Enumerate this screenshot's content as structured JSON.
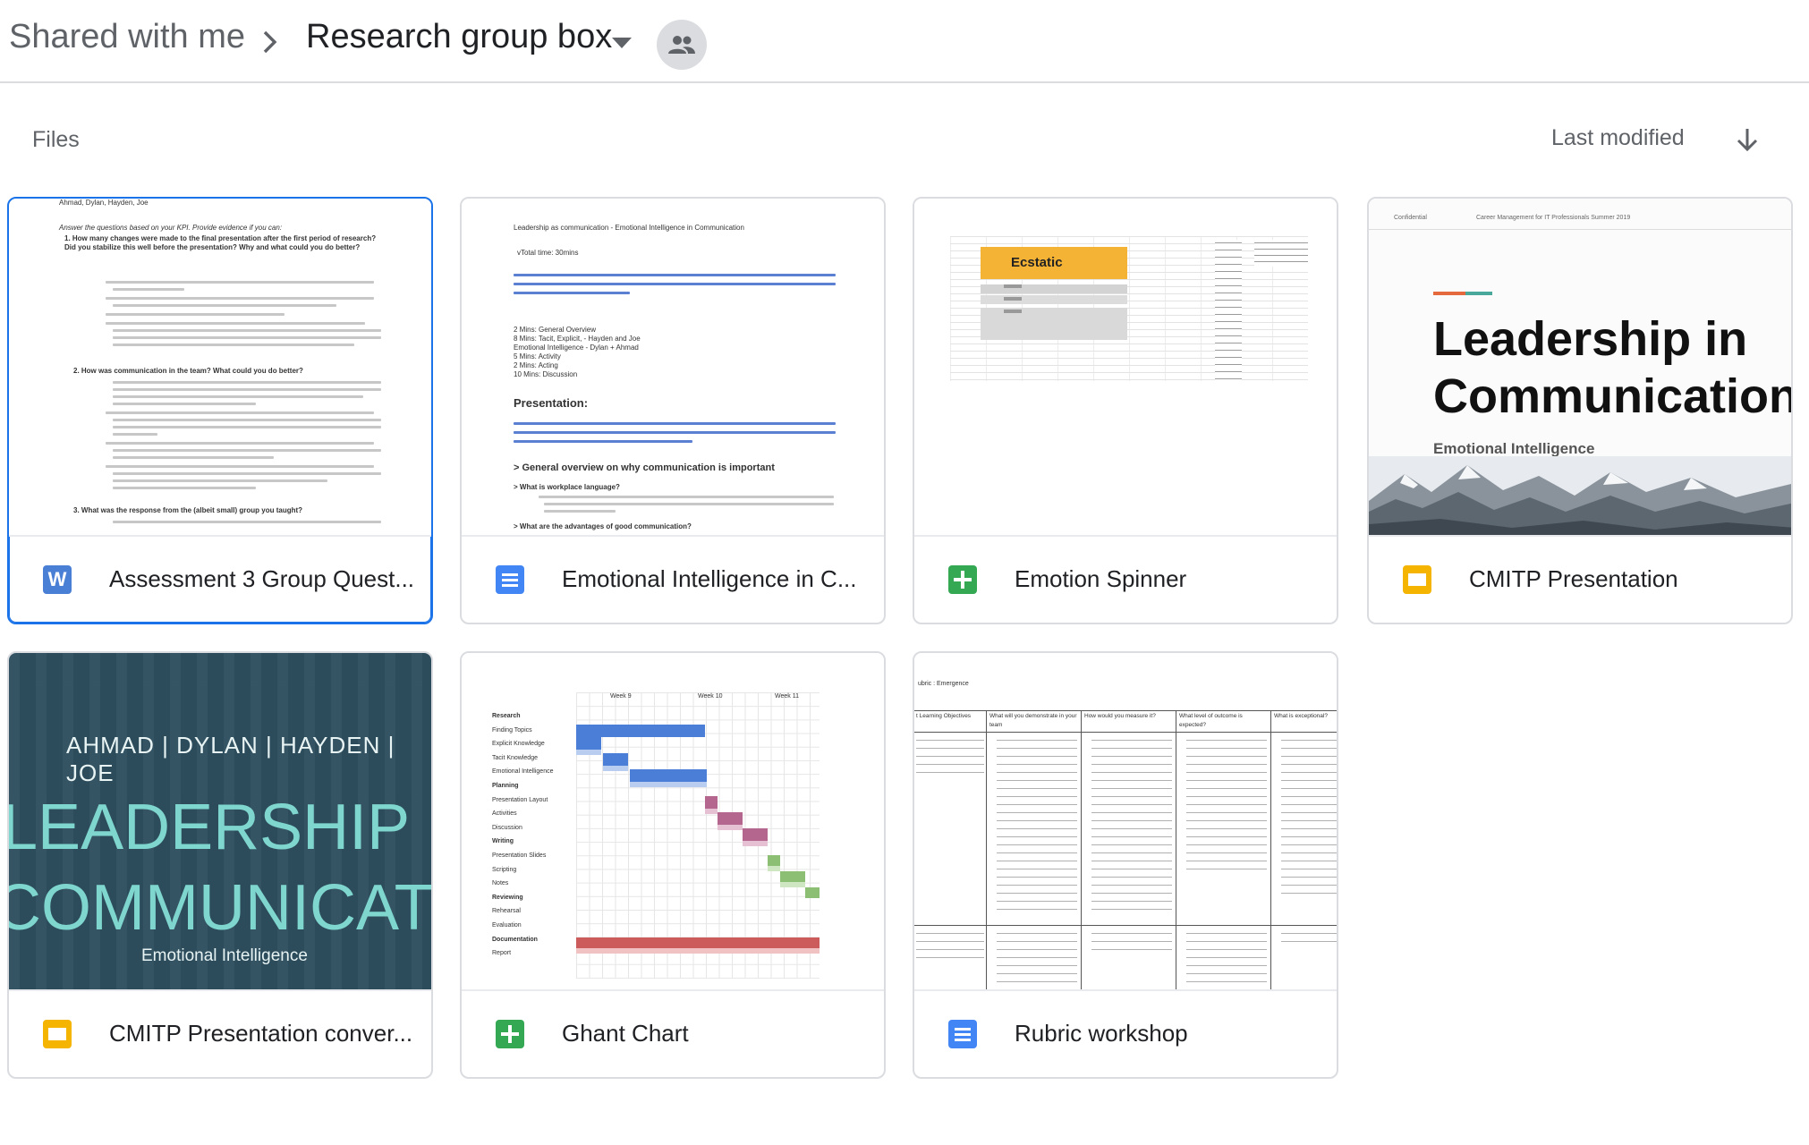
{
  "breadcrumb": {
    "root": "Shared with me",
    "current": "Research group box"
  },
  "section": {
    "label": "Files",
    "sort_label": "Last modified"
  },
  "files": [
    {
      "name": "Assessment 3 Group Quest...",
      "type": "word",
      "thumb": {
        "authors": "Ahmad, Dylan, Hayden, Joe",
        "intro": "Answer the questions based on your KPI. Provide evidence if you can:",
        "q1": "1. How many changes were made to the final presentation after the first period of research? Did you stabilize this well before the presentation? Why and what could you do better?",
        "q2": "2. How was communication in the team? What could you do better?",
        "q3": "3. What was the response from the (albeit small) group you taught?"
      }
    },
    {
      "name": "Emotional Intelligence in C...",
      "type": "doc",
      "thumb": {
        "heading": "Leadership as communication - Emotional Intelligence in Communication",
        "total": "vTotal time: 30mins",
        "schedule": [
          "2 Mins: General Overview",
          "8 Mins: Tacit, Explicit, - Hayden and Joe",
          "Emotional Intelligence - Dylan + Ahmad",
          "5 Mins: Activity",
          "2 Mins: Acting",
          "10 Mins: Discussion"
        ],
        "presentation": "Presentation:",
        "overview": "> General overview on why communication is important",
        "q1": "> What is workplace language?",
        "q2": "> What are the advantages of good communication?"
      }
    },
    {
      "name": "Emotion Spinner",
      "type": "sheet",
      "thumb": {
        "cell": "Ecstatic"
      }
    },
    {
      "name": "CMITP Presentation",
      "type": "slides",
      "thumb": {
        "top_left": "Confidential",
        "top_mid": "Career Management for IT Professionals Summer 2019",
        "title": "Leadership in Communication",
        "subtitle": "Emotional Intelligence"
      }
    },
    {
      "name": "CMITP Presentation conver...",
      "type": "slides",
      "thumb": {
        "names": "AHMAD | DYLAN | HAYDEN | JOE",
        "title_line1": "LEADERSHIP IN",
        "title_line2": "COMMUNICATION",
        "subtitle": "Emotional Intelligence"
      }
    },
    {
      "name": "Ghant Chart",
      "type": "sheet",
      "thumb": {
        "weeks": [
          "Week 9",
          "Week 10",
          "Week 11"
        ],
        "rows": [
          "Research",
          "Finding Topics",
          "Explicit Knowledge",
          "Tacit Knowledge",
          "Emotional Intelligence",
          "Planning",
          "Presentation Layout",
          "Activities",
          "Discussion",
          "Writing",
          "Presentation Slides",
          "Scripting",
          "Notes",
          "Reviewing",
          "Rehearsal",
          "Evaluation",
          "Documentation",
          "Report"
        ]
      }
    },
    {
      "name": "Rubric workshop",
      "type": "doc",
      "thumb": {
        "heading": "ubric : Emergence",
        "cols": [
          "t Learning Objectives",
          "What will you demonstrate in your team",
          "How would you measure it?",
          "What level of outcome is expected?",
          "What is exceptional?"
        ]
      }
    }
  ],
  "colors": {
    "word": "#4a7fd6",
    "doc": "#4285f4",
    "sheet": "#34a853",
    "slides": "#f4b400",
    "selected_border": "#1a73e8"
  },
  "icons": [
    "chevron-right-icon",
    "dropdown-caret-icon",
    "shared-people-icon",
    "arrow-down-icon"
  ]
}
